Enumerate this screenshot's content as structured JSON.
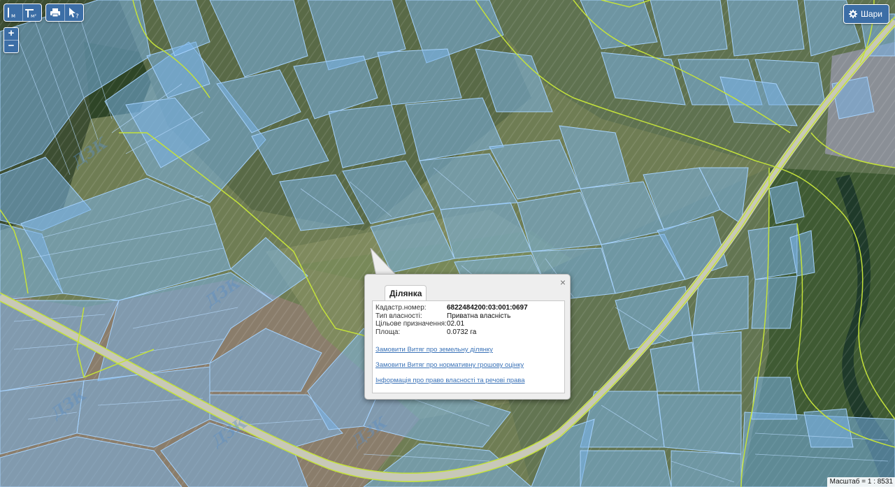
{
  "toolbar": {
    "measure_distance_sub": "м",
    "measure_area_sub": "м²",
    "identify_label": "?"
  },
  "zoom": {
    "in_label": "+",
    "out_label": "−"
  },
  "layers_button": {
    "label": "Шари"
  },
  "popup": {
    "close_label": "×",
    "tab_label": "Ділянка",
    "fields": [
      {
        "key": "Кадастр.номер:",
        "value": "6822484200:03:001:0697",
        "bold": true
      },
      {
        "key": "Тип власності:",
        "value": "Приватна власність",
        "bold": false
      },
      {
        "key": "Цільове призначення:",
        "value": "02.01",
        "bold": false
      },
      {
        "key": "Площа:",
        "value": "0.0732 га",
        "bold": false
      }
    ],
    "links": [
      "Замовити Витяг про земельну ділянку",
      "Замовити Витяг про нормативну грошову оцінку",
      "Інформація про право власності та речові права"
    ]
  },
  "scale": {
    "label": "Масштаб = 1 : 8531"
  },
  "watermark": "ДЗК",
  "colors": {
    "parcel_fill": "#7ab2e6",
    "parcel_stroke": "#a8d4ff",
    "boundary_line": "#c4e23a",
    "button_blue": "#3c6ea6",
    "link_blue": "#3b73b8"
  }
}
